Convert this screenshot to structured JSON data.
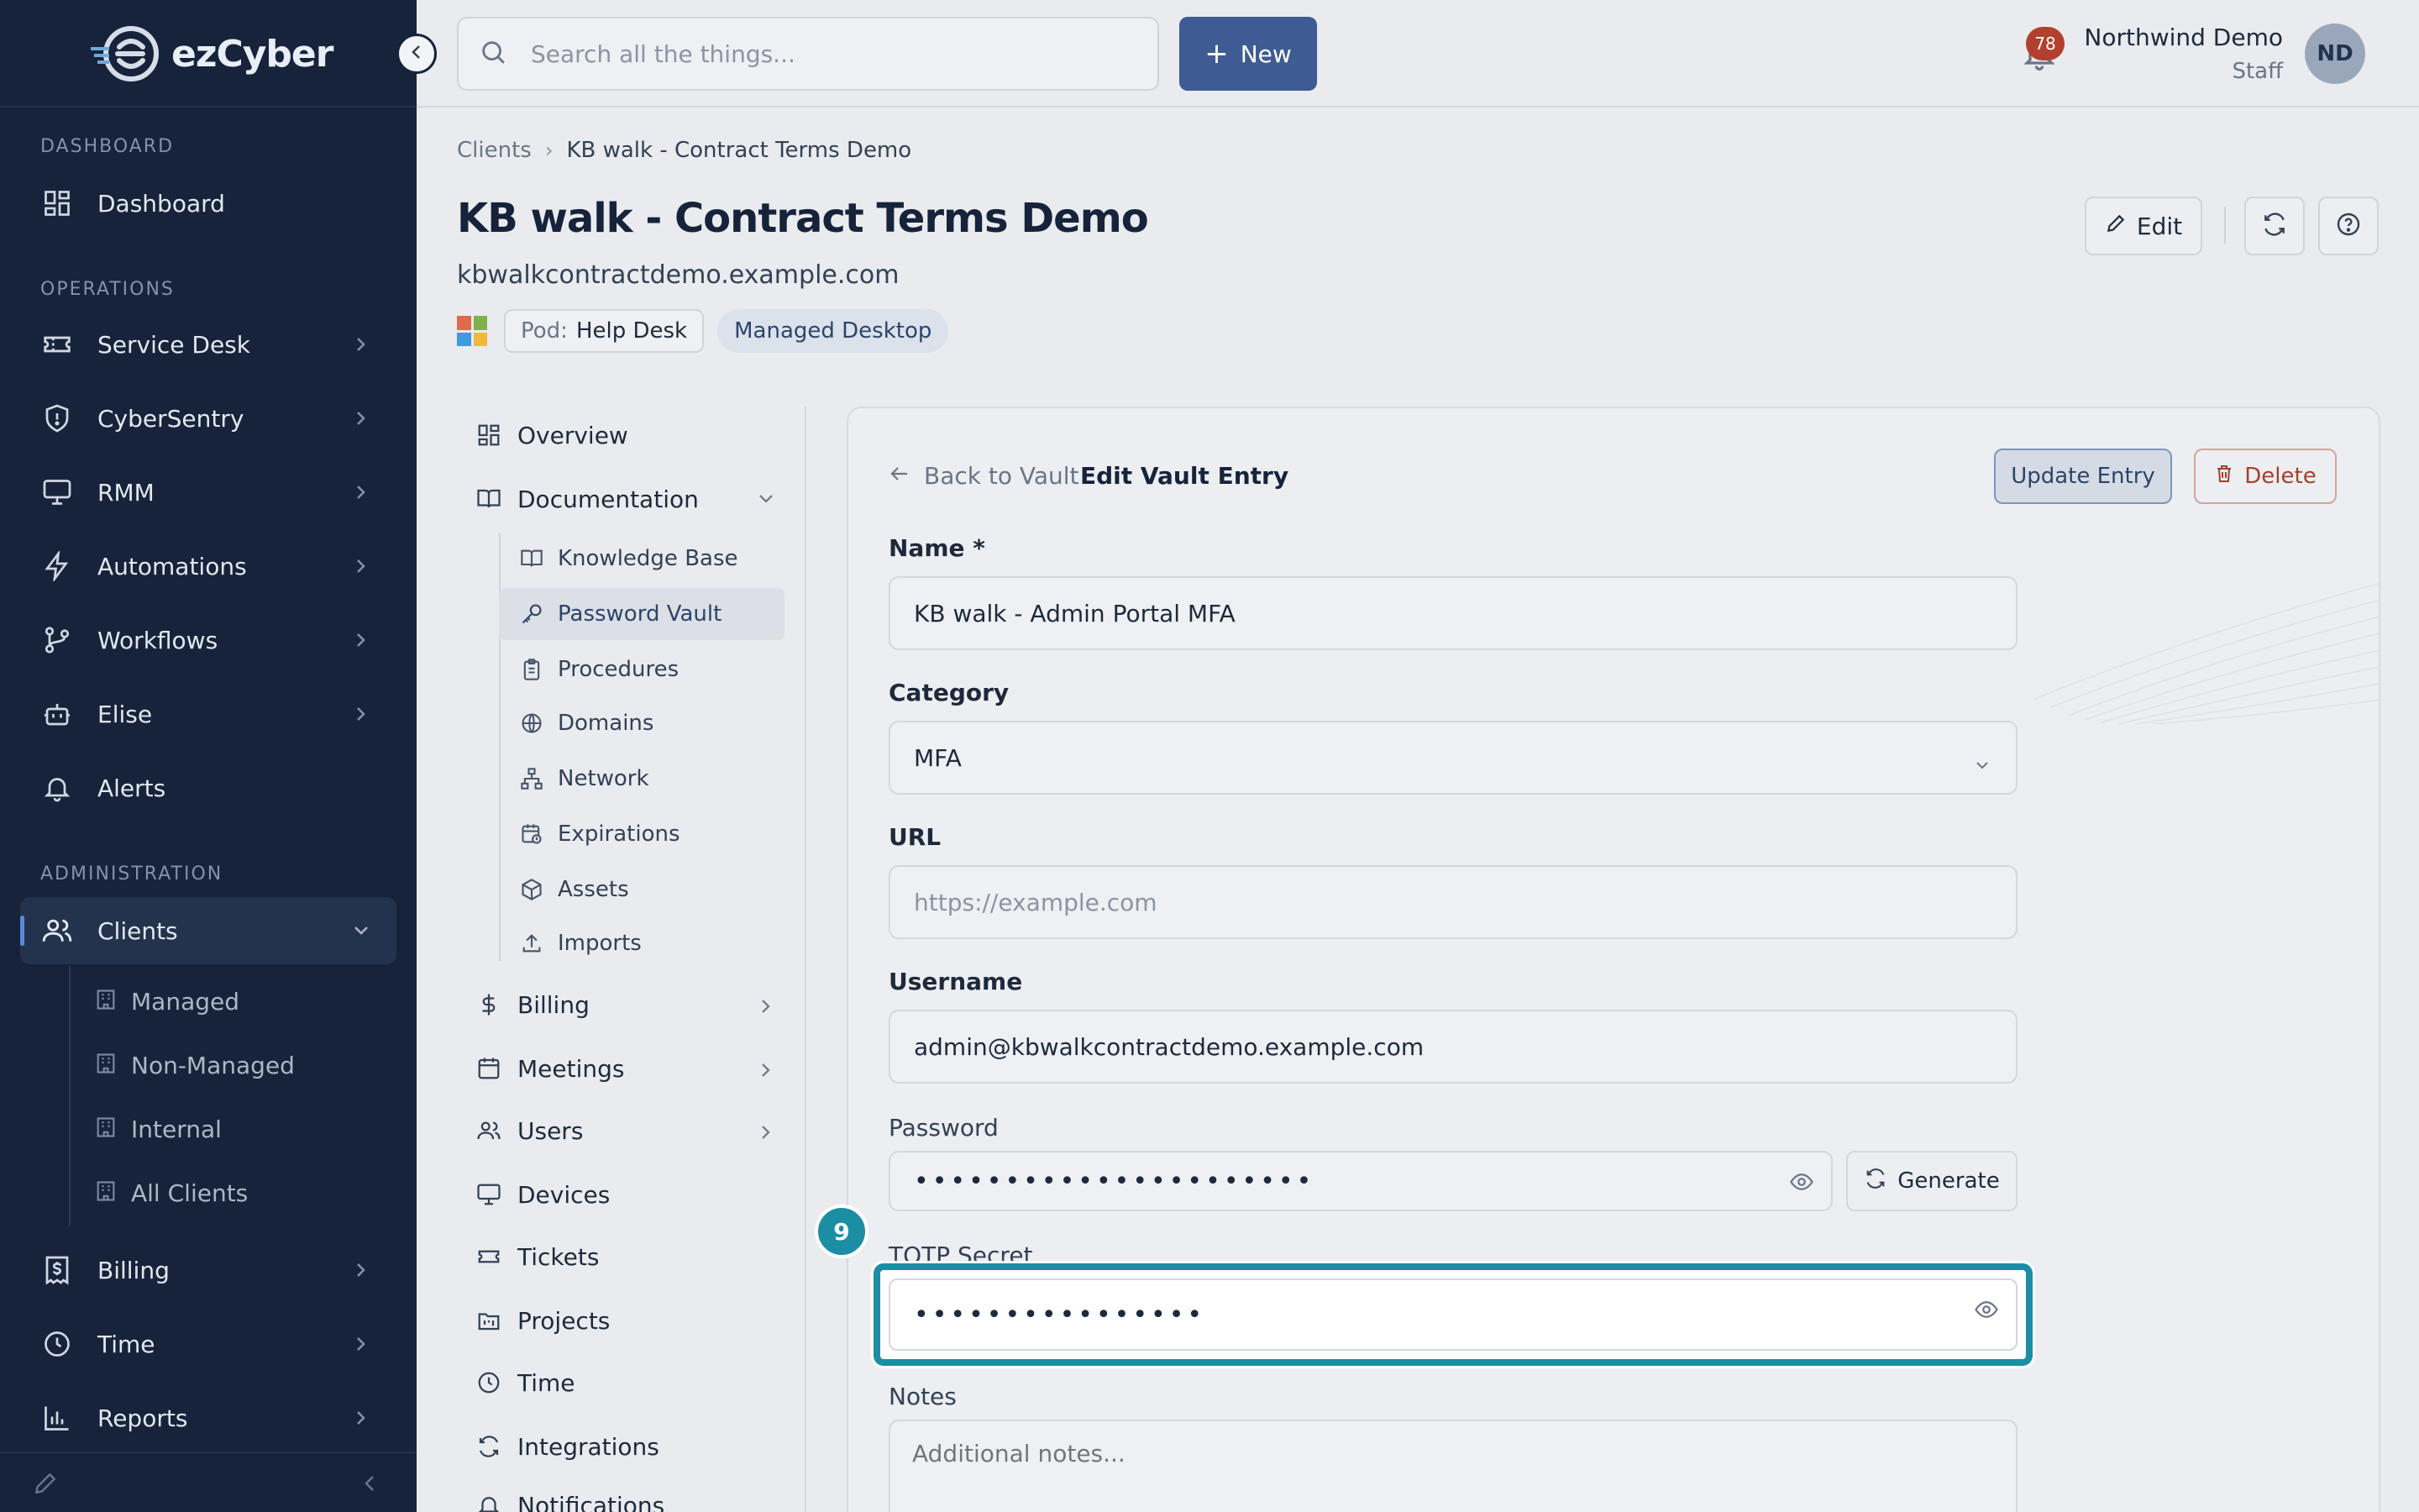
{
  "brand": {
    "name": "ezCyber"
  },
  "sidebar": {
    "sections": {
      "dashboard": "DASHBOARD",
      "operations": "OPERATIONS",
      "administration": "ADMINISTRATION"
    },
    "items": [
      {
        "label": "Dashboard"
      },
      {
        "label": "Service Desk"
      },
      {
        "label": "CyberSentry"
      },
      {
        "label": "RMM"
      },
      {
        "label": "Automations"
      },
      {
        "label": "Workflows"
      },
      {
        "label": "Elise"
      },
      {
        "label": "Alerts"
      },
      {
        "label": "Clients"
      },
      {
        "label": "Billing"
      },
      {
        "label": "Time"
      },
      {
        "label": "Reports"
      }
    ],
    "client_sub": [
      {
        "label": "Managed"
      },
      {
        "label": "Non-Managed"
      },
      {
        "label": "Internal"
      },
      {
        "label": "All Clients"
      }
    ]
  },
  "topbar": {
    "search_placeholder": "Search all the things...",
    "new_label": "New",
    "notification_count": "78",
    "user_name": "Northwind Demo",
    "user_role": "Staff",
    "avatar_initials": "ND"
  },
  "header": {
    "breadcrumb": [
      "Clients",
      "KB walk - Contract Terms Demo"
    ],
    "title": "KB walk - Contract Terms Demo",
    "domain": "kbwalkcontractdemo.example.com",
    "pod_key": "Pod:",
    "pod_value": "Help Desk",
    "tag": "Managed Desktop",
    "edit_label": "Edit"
  },
  "subnav": {
    "items": {
      "overview": "Overview",
      "documentation": "Documentation",
      "billing": "Billing",
      "meetings": "Meetings",
      "users": "Users",
      "devices": "Devices",
      "tickets": "Tickets",
      "projects": "Projects",
      "time": "Time",
      "integrations": "Integrations",
      "notifications": "Notifications"
    },
    "doc_children": [
      {
        "label": "Knowledge Base"
      },
      {
        "label": "Password Vault"
      },
      {
        "label": "Procedures"
      },
      {
        "label": "Domains"
      },
      {
        "label": "Network"
      },
      {
        "label": "Expirations"
      },
      {
        "label": "Assets"
      },
      {
        "label": "Imports"
      }
    ]
  },
  "form": {
    "back_label": "Back to Vault",
    "title": "Edit Vault Entry",
    "update_label": "Update Entry",
    "delete_label": "Delete",
    "name_label": "Name *",
    "name_value": "KB walk - Admin Portal MFA",
    "category_label": "Category",
    "category_value": "MFA",
    "url_label": "URL",
    "url_placeholder": "https://example.com",
    "username_label": "Username",
    "username_value": "admin@kbwalkcontractdemo.example.com",
    "password_label": "Password",
    "password_mask": "••••••••••••••••••••••",
    "generate_label": "Generate",
    "totp_label": "TOTP Secret",
    "totp_mask": "••••••••••••••••",
    "notes_label": "Notes",
    "notes_placeholder": "Additional notes..."
  },
  "annotation": {
    "step": "9"
  },
  "colors": {
    "sidebar_bg": "#16233a",
    "primary": "#3e5c93",
    "highlight": "#1b8ea4",
    "danger": "#a3402e",
    "badge": "#b3402e"
  }
}
